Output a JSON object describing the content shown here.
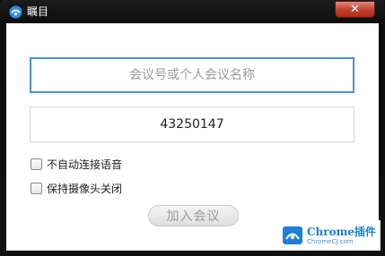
{
  "window": {
    "title": "瞩目",
    "app_icon": "app-logo-icon",
    "close_label": "✕"
  },
  "form": {
    "meeting_name_placeholder": "会议号或个人会议名称",
    "meeting_name_value": "",
    "meeting_number_value": "43250147",
    "option_no_auto_audio": "不自动连接语音",
    "option_no_auto_audio_checked": false,
    "option_keep_camera_off": "保持摄像头关闭",
    "option_keep_camera_off_checked": false,
    "join_button": "加入会议"
  },
  "watermark": {
    "main_text": "Chrome插件",
    "sub_text": "ChromeCJ.com"
  },
  "colors": {
    "accent": "#4a90d9",
    "close": "#c3432f",
    "watermark": "#1e7fd6"
  }
}
